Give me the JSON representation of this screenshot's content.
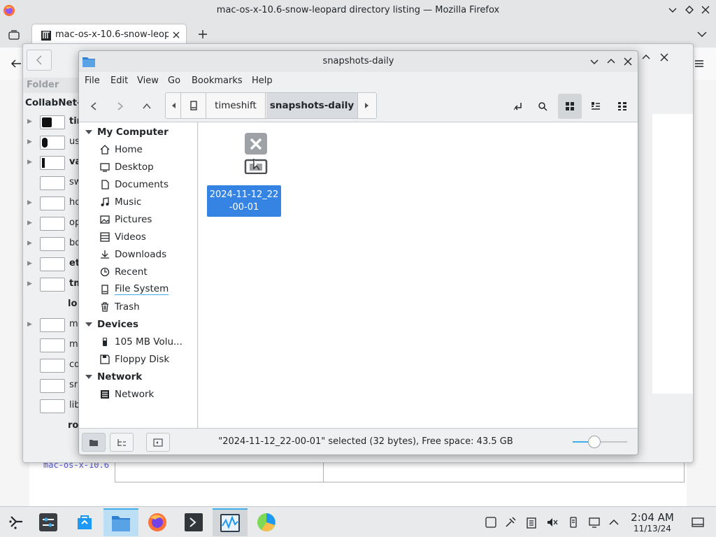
{
  "firefox": {
    "window_title": "mac-os-x-10.6-snow-leopard directory listing — Mozilla Firefox",
    "tab_title": "mac-os-x-10.6-snow-leopa",
    "page_link_fragment": "mac-os-x-10.6"
  },
  "background_window": {
    "sidebar_header": "Folder",
    "host_label": "CollabNet-V",
    "rows": [
      {
        "text": "tim",
        "bold": true
      },
      {
        "text": "us",
        "bold": false
      },
      {
        "text": "va",
        "bold": true
      },
      {
        "text": "sw",
        "bold": false
      },
      {
        "text": "ho",
        "bold": false
      },
      {
        "text": "op",
        "bold": false
      },
      {
        "text": "bo",
        "bold": false
      },
      {
        "text": "et",
        "bold": true
      },
      {
        "text": "tm",
        "bold": true
      },
      {
        "text": "lo",
        "bold": true
      },
      {
        "text": "me",
        "bold": false
      },
      {
        "text": "mi",
        "bold": false
      },
      {
        "text": "cd",
        "bold": false
      },
      {
        "text": "sr",
        "bold": false
      },
      {
        "text": "lib",
        "bold": false
      },
      {
        "text": "ro",
        "bold": true
      }
    ]
  },
  "nemo": {
    "window_title": "snapshots-daily",
    "menu": [
      "File",
      "Edit",
      "View",
      "Go",
      "Bookmarks",
      "Help"
    ],
    "breadcrumbs": [
      "timeshift",
      "snapshots-daily"
    ],
    "sidebar": {
      "my_computer": {
        "header": "My Computer",
        "items": [
          {
            "label": "Home",
            "icon": "home-icon"
          },
          {
            "label": "Desktop",
            "icon": "desktop-icon"
          },
          {
            "label": "Documents",
            "icon": "documents-icon"
          },
          {
            "label": "Music",
            "icon": "music-icon"
          },
          {
            "label": "Pictures",
            "icon": "pictures-icon"
          },
          {
            "label": "Videos",
            "icon": "videos-icon"
          },
          {
            "label": "Downloads",
            "icon": "downloads-icon"
          },
          {
            "label": "Recent",
            "icon": "recent-icon"
          },
          {
            "label": "File System",
            "icon": "drive-icon"
          },
          {
            "label": "Trash",
            "icon": "trash-icon"
          }
        ]
      },
      "devices": {
        "header": "Devices",
        "items": [
          {
            "label": "105 MB Volu...",
            "icon": "usb-drive-icon"
          },
          {
            "label": "Floppy Disk",
            "icon": "floppy-icon"
          }
        ]
      },
      "network": {
        "header": "Network",
        "items": [
          {
            "label": "Network",
            "icon": "network-icon"
          }
        ]
      }
    },
    "files": [
      {
        "name": "2024-11-12_22-00-01",
        "selected": true,
        "icon": "unreadable-folder-icon"
      }
    ],
    "status_text": "\"2024-11-12_22-00-01\" selected (32 bytes), Free space: 43.5 GB",
    "zoom_level": 0.36
  },
  "taskbar": {
    "apps": [
      "application-launcher-icon",
      "settings-icon",
      "discover-icon",
      "file-manager-icon",
      "firefox-icon",
      "terminal-icon",
      "system-monitor-icon",
      "disk-usage-icon"
    ],
    "clock_time": "2:04 AM",
    "clock_date": "11/13/24"
  },
  "colors": {
    "selection": "#3584e4",
    "accent": "#3daee9"
  }
}
